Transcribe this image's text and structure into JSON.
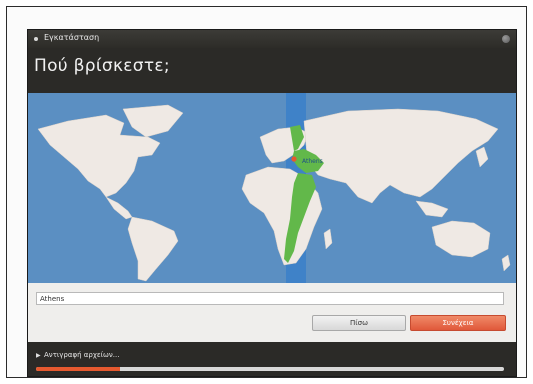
{
  "window": {
    "title": "Εγκατάσταση"
  },
  "header": {
    "title": "Πού βρίσκεστε;"
  },
  "map": {
    "selected_city": "Athens"
  },
  "timezone_input": {
    "value": "Athens"
  },
  "buttons": {
    "back_label": "Πίσω",
    "continue_label": "Συνέχεια"
  },
  "progress": {
    "label": "Αντιγραφή αρχείων...",
    "fraction": 0.18
  },
  "colors": {
    "accent": "#e5592f",
    "ocean": "#5b8fc2",
    "land": "#efe9e4",
    "timezone_region": "#62b84a"
  }
}
